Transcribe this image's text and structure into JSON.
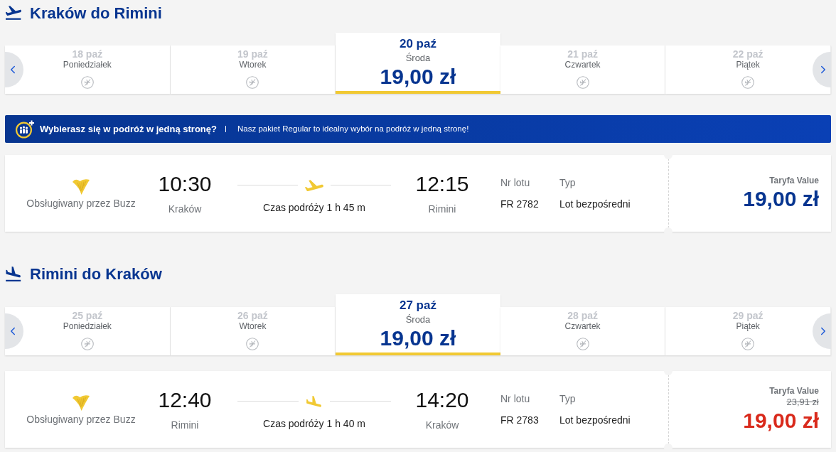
{
  "sections": [
    {
      "kind": "departure",
      "title": "Kraków do Rimini",
      "dates": [
        {
          "date": "18 paź",
          "weekday": "Poniedziałek",
          "selected": false
        },
        {
          "date": "19 paź",
          "weekday": "Wtorek",
          "selected": false
        },
        {
          "date": "20 paź",
          "weekday": "Środa",
          "price": "19,00 zł",
          "selected": true
        },
        {
          "date": "21 paź",
          "weekday": "Czwartek",
          "selected": false
        },
        {
          "date": "22 paź",
          "weekday": "Piątek",
          "selected": false
        }
      ],
      "banner": {
        "headline": "Wybierasz się w podróż w jedną stronę?",
        "text": "Nasz pakiet Regular to idealny wybór na podróż w jedną stronę!"
      },
      "flight": {
        "operator": "Obsługiwany przez Buzz",
        "departure_time": "10:30",
        "departure_city": "Kraków",
        "duration": "Czas podróży 1 h 45 m",
        "arrival_time": "12:15",
        "arrival_city": "Rimini",
        "flight_number_label": "Nr lotu",
        "flight_number": "FR 2782",
        "type_label": "Typ",
        "type": "Lot bezpośredni",
        "fare": "Taryfa Value",
        "price": "19,00 zł",
        "discounted": false
      }
    },
    {
      "kind": "arrival",
      "title": "Rimini do Kraków",
      "dates": [
        {
          "date": "25 paź",
          "weekday": "Poniedziałek",
          "selected": false
        },
        {
          "date": "26 paź",
          "weekday": "Wtorek",
          "selected": false
        },
        {
          "date": "27 paź",
          "weekday": "Środa",
          "price": "19,00 zł",
          "selected": true
        },
        {
          "date": "28 paź",
          "weekday": "Czwartek",
          "selected": false
        },
        {
          "date": "29 paź",
          "weekday": "Piątek",
          "selected": false
        }
      ],
      "flight": {
        "operator": "Obsługiwany przez Buzz",
        "departure_time": "12:40",
        "departure_city": "Rimini",
        "duration": "Czas podróży 1 h 40 m",
        "arrival_time": "14:20",
        "arrival_city": "Kraków",
        "flight_number_label": "Nr lotu",
        "flight_number": "FR 2783",
        "type_label": "Typ",
        "type": "Lot bezpośredni",
        "fare": "Taryfa Value",
        "old_price": "23,91 zł",
        "price": "19,00 zł",
        "discounted": true
      }
    }
  ]
}
